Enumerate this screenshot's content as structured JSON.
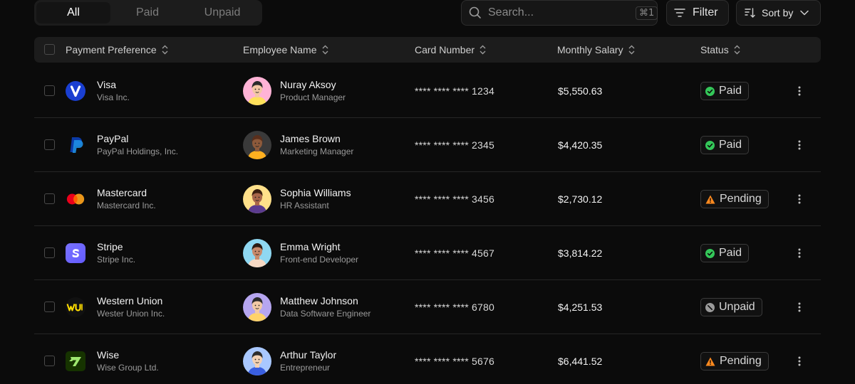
{
  "tabs": [
    "All",
    "Paid",
    "Unpaid"
  ],
  "search": {
    "placeholder": "Search...",
    "shortcut": "⌘1"
  },
  "toolbar": {
    "filter_label": "Filter",
    "sort_label": "Sort by"
  },
  "columns": [
    "Payment Preference",
    "Employee Name",
    "Card Number",
    "Monthly Salary",
    "Status"
  ],
  "colors": {
    "paid": "#34c759",
    "pending": "#ff8a1f",
    "unpaid": "#9a9a9a",
    "visa": "#1a3fd1",
    "paypal_dark": "#0b3aa6",
    "paypal_light": "#1e8fe6",
    "mastercard_red": "#eb001b",
    "mastercard_orange": "#f79e1b",
    "stripe": "#635bff",
    "western_union": "#ffdd00",
    "wise": "#9fe870"
  },
  "rows": [
    {
      "payment": "Visa",
      "company": "Visa Inc.",
      "icon": "visa-logo-icon",
      "name": "Nuray Aksoy",
      "role": "Product Manager",
      "card": "**** **** **** 1234",
      "salary": "$5,550.63",
      "status": "Paid",
      "status_type": "paid"
    },
    {
      "payment": "PayPal",
      "company": "PayPal Holdings, Inc.",
      "icon": "paypal-logo-icon",
      "name": "James Brown",
      "role": "Marketing Manager",
      "card": "**** **** **** 2345",
      "salary": "$4,420.35",
      "status": "Paid",
      "status_type": "paid"
    },
    {
      "payment": "Mastercard",
      "company": "Mastercard Inc.",
      "icon": "mastercard-logo-icon",
      "name": "Sophia Williams",
      "role": "HR Assistant",
      "card": "**** **** **** 3456",
      "salary": "$2,730.12",
      "status": "Pending",
      "status_type": "pending"
    },
    {
      "payment": "Stripe",
      "company": "Stripe Inc.",
      "icon": "stripe-logo-icon",
      "name": "Emma Wright",
      "role": "Front-end Developer",
      "card": "**** **** **** 4567",
      "salary": "$3,814.22",
      "status": "Paid",
      "status_type": "paid"
    },
    {
      "payment": "Western Union",
      "company": "Wester Union Inc.",
      "icon": "western-union-logo-icon",
      "name": "Matthew Johnson",
      "role": "Data Software Engineer",
      "card": "**** **** **** 6780",
      "salary": "$4,251.53",
      "status": "Unpaid",
      "status_type": "unpaid"
    },
    {
      "payment": "Wise",
      "company": "Wise Group Ltd.",
      "icon": "wise-logo-icon",
      "name": "Arthur Taylor",
      "role": "Entrepreneur",
      "card": "**** **** **** 5676",
      "salary": "$6,441.52",
      "status": "Pending",
      "status_type": "pending"
    }
  ]
}
